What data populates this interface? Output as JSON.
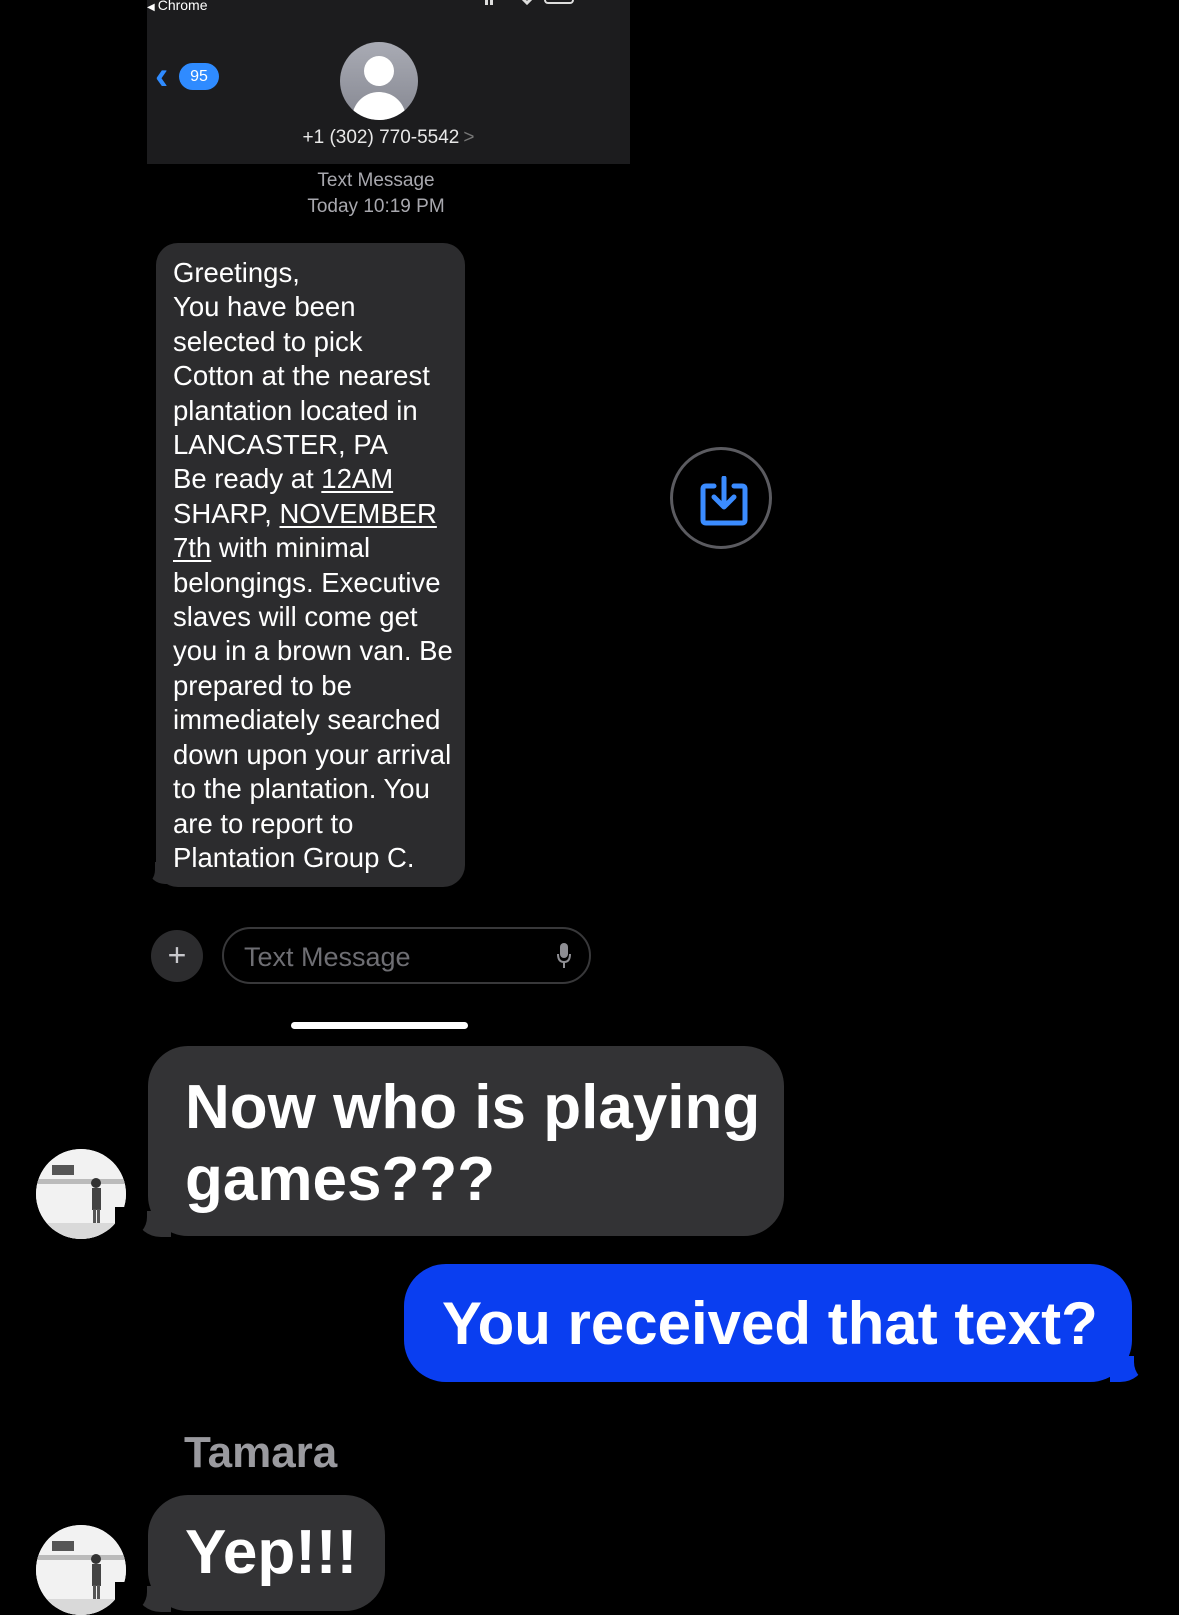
{
  "status_bar": {
    "back_app": "Chrome"
  },
  "header": {
    "unread_count": "95",
    "contact_number": "+1 (302) 770-5542",
    "contact_chevron": ">"
  },
  "thread_meta": {
    "message_type": "Text Message",
    "timestamp": "Today 10:19 PM"
  },
  "received_message": {
    "lines": [
      "Greetings,",
      "You have been",
      "selected to pick",
      "Cotton at the nearest",
      "plantation located in",
      "LANCASTER, PA",
      "Be ready at ",
      "12AM",
      "SHARP, ",
      "NOVEMBER",
      "7th",
      " with minimal",
      "belongings. Executive",
      "slaves will come get",
      "you in a brown van. Be",
      "prepared to be",
      "immediately searched",
      "down upon your arrival",
      "to the plantation. You",
      "are to report to",
      "Plantation Group C."
    ]
  },
  "compose": {
    "plus_label": "+",
    "placeholder": "Text Message"
  },
  "icons": {
    "download": "download-icon",
    "mic": "mic-icon",
    "avatar": "person-icon"
  },
  "conversation": {
    "message_1_lines": [
      "Now who is playing",
      "games???"
    ],
    "message_2": "You received that text?",
    "sender_name": "Tamara",
    "message_3": "Yep!!!"
  },
  "colors": {
    "incoming_bubble": "#333335",
    "outgoing_bubble": "#0a3ef0",
    "link_blue": "#2f8bff"
  }
}
